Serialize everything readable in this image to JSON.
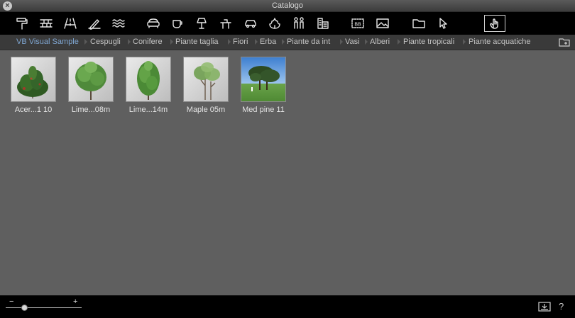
{
  "window": {
    "title": "Catalogo",
    "close_glyph": "×"
  },
  "toolbar": {
    "icons": [
      "paint-roller-icon",
      "brick-wall-icon",
      "road-icon",
      "pencil-terrain-icon",
      "water-icon",
      "sofa-icon",
      "cup-icon",
      "lamp-icon",
      "table-chairs-icon",
      "car-icon",
      "leaf-icon",
      "people-icon",
      "buildings-icon",
      "billboard-icon",
      "picture-icon",
      "folder-icon",
      "pointer-icon",
      "hand-icon"
    ],
    "selected": "hand-icon",
    "billboard_text": "BB"
  },
  "categories": [
    {
      "label": "VB Visual Sample",
      "active": true
    },
    {
      "label": "Cespugli"
    },
    {
      "label": "Conifere"
    },
    {
      "label": "Piante taglia"
    },
    {
      "label": "Fiori"
    },
    {
      "label": "Erba"
    },
    {
      "label": "Piante da int"
    },
    {
      "label": "Vasi"
    },
    {
      "label": "Alberi"
    },
    {
      "label": "Piante tropicali"
    },
    {
      "label": "Piante acquatiche"
    }
  ],
  "items": [
    {
      "label": "Acer...1 10",
      "thumb": "bush-thumbnail"
    },
    {
      "label": "Lime...08m",
      "thumb": "tree-thumbnail"
    },
    {
      "label": "Lime...14m",
      "thumb": "tree-thumbnail"
    },
    {
      "label": "Maple 05m",
      "thumb": "sapling-thumbnail"
    },
    {
      "label": "Med pine 11",
      "thumb": "pine-sky-thumbnail"
    }
  ],
  "zoom": {
    "minus": "−",
    "plus": "+",
    "level": 0.25
  },
  "footer": {
    "help": "?"
  },
  "colors": {
    "active_category": "#7fa6d2",
    "toolbar_bg": "#000000",
    "content_bg": "#5f5f5f"
  }
}
